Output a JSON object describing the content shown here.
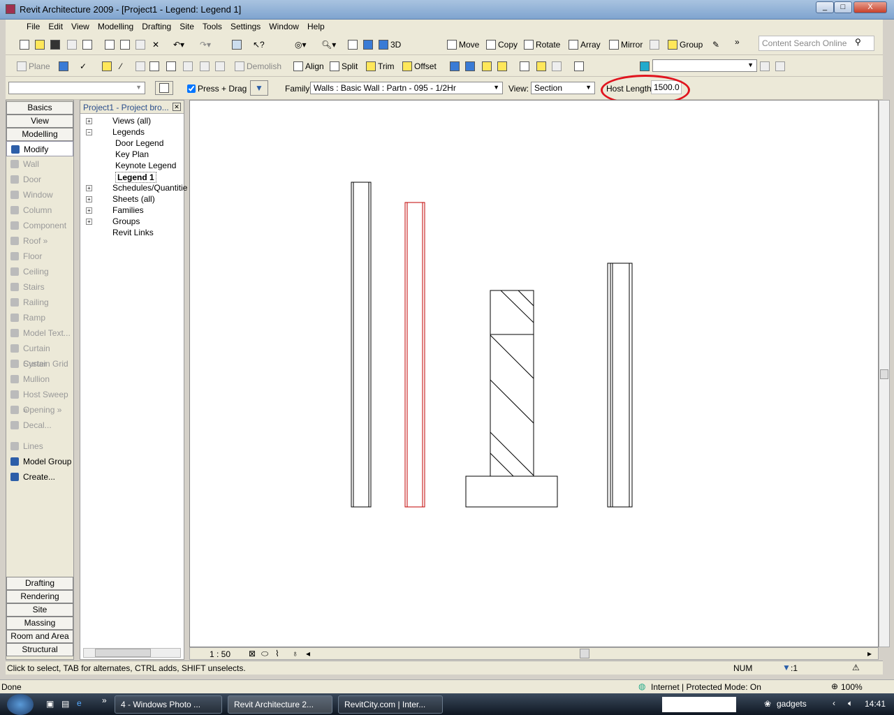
{
  "window": {
    "title": "Revit Architecture 2009 - [Project1 - Legend: Legend 1]",
    "min": "_",
    "max": "□",
    "close": "X"
  },
  "menu": [
    "File",
    "Edit",
    "View",
    "Modelling",
    "Drafting",
    "Site",
    "Tools",
    "Settings",
    "Window",
    "Help"
  ],
  "toolbar1": {
    "three_d": "3D",
    "move": "Move",
    "copy": "Copy",
    "rotate": "Rotate",
    "array": "Array",
    "mirror": "Mirror",
    "group": "Group",
    "more": "»",
    "search_placeholder": "Content Search Online"
  },
  "toolbar2": {
    "plane": "Plane",
    "demolish": "Demolish",
    "align": "Align",
    "split": "Split",
    "trim": "Trim",
    "offset": "Offset"
  },
  "options": {
    "press_drag": "Press + Drag",
    "press_drag_checked": true,
    "family_label": "Family:",
    "family_value": "Walls : Basic Wall : Partn - 095 - 1/2Hr",
    "view_label": "View:",
    "view_value": "Section",
    "host_length_label": "Host Length:",
    "host_length_value": "1500.0",
    "highlight_color": "#e0141e"
  },
  "designbar": {
    "tabs_top": [
      "Basics",
      "View",
      "Modelling"
    ],
    "items": [
      {
        "label": "Modify",
        "enabled": true
      },
      {
        "label": "Wall",
        "enabled": false
      },
      {
        "label": "Door",
        "enabled": false
      },
      {
        "label": "Window",
        "enabled": false
      },
      {
        "label": "Column",
        "enabled": false
      },
      {
        "label": "Component",
        "enabled": false
      },
      {
        "label": "Roof »",
        "enabled": false
      },
      {
        "label": "Floor",
        "enabled": false
      },
      {
        "label": "Ceiling",
        "enabled": false
      },
      {
        "label": "Stairs",
        "enabled": false
      },
      {
        "label": "Railing",
        "enabled": false
      },
      {
        "label": "Ramp",
        "enabled": false
      },
      {
        "label": "Model Text...",
        "enabled": false
      },
      {
        "label": "Curtain Syster",
        "enabled": false
      },
      {
        "label": "Curtain Grid",
        "enabled": false
      },
      {
        "label": "Mullion",
        "enabled": false
      },
      {
        "label": "Host Sweep »",
        "enabled": false
      },
      {
        "label": "Opening »",
        "enabled": false
      },
      {
        "label": "Decal...",
        "enabled": false
      },
      {
        "label": "Lines",
        "enabled": false
      },
      {
        "label": "Model Group",
        "enabled": true
      },
      {
        "label": "Create...",
        "enabled": true
      }
    ],
    "tabs_bottom": [
      "Drafting",
      "Rendering",
      "Site",
      "Massing",
      "Room and Area",
      "Structural"
    ]
  },
  "browser": {
    "title": "Project1 - Project bro...",
    "tree": [
      {
        "label": "Views (all)",
        "level": 0,
        "toggle": "+"
      },
      {
        "label": "Legends",
        "level": 0,
        "toggle": "-"
      },
      {
        "label": "Door Legend",
        "level": 1
      },
      {
        "label": "Key Plan",
        "level": 1
      },
      {
        "label": "Keynote Legend",
        "level": 1
      },
      {
        "label": "Legend 1",
        "level": 1,
        "bold": true
      },
      {
        "label": "Schedules/Quantitie",
        "level": 0,
        "toggle": "+"
      },
      {
        "label": "Sheets (all)",
        "level": 0,
        "toggle": "+"
      },
      {
        "label": "Families",
        "level": 0,
        "toggle": "+"
      },
      {
        "label": "Groups",
        "level": 0,
        "toggle": "+"
      },
      {
        "label": "Revit Links",
        "level": 0
      }
    ]
  },
  "viewbar": {
    "scale": "1 : 50"
  },
  "status": {
    "text": "Click to select, TAB for alternates, CTRL adds, SHIFT unselects.",
    "num": "NUM",
    "filter": ":1"
  },
  "ie": {
    "done": "Done",
    "zone": "Internet | Protected Mode: On",
    "zoom": "100%"
  },
  "taskbar": {
    "tasks": [
      "4 - Windows Photo ...",
      "Revit Architecture 2...",
      "RevitCity.com | Inter..."
    ],
    "gadgets": "gadgets",
    "time": "14:41",
    "more": "»"
  }
}
